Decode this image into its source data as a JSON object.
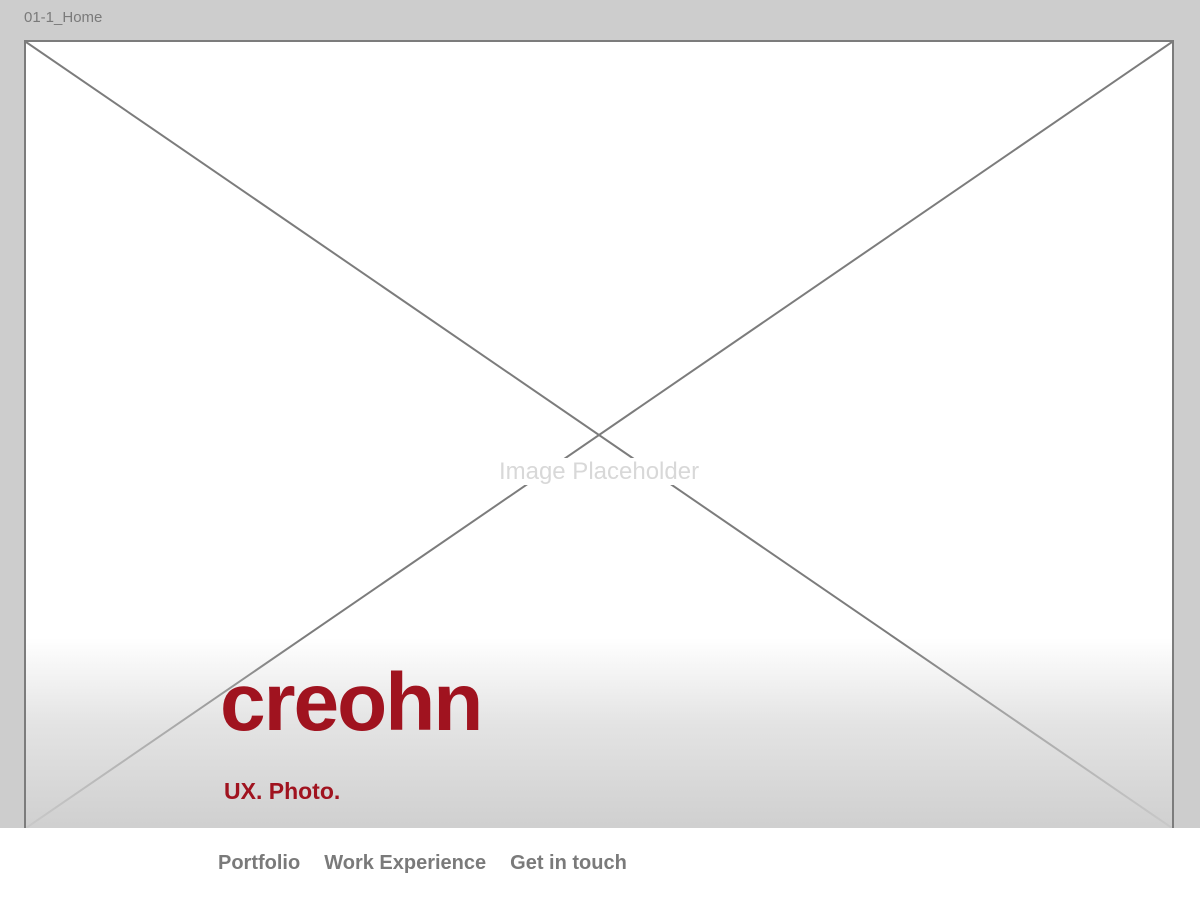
{
  "artboard": {
    "label": "01-1_Home"
  },
  "hero": {
    "placeholder_text": "Image Placeholder",
    "brand": "creohn",
    "tagline": "UX. Photo."
  },
  "nav": {
    "items": [
      {
        "label": "Portfolio"
      },
      {
        "label": "Work Experience"
      },
      {
        "label": "Get in touch"
      }
    ]
  },
  "colors": {
    "brand_red": "#a0131f",
    "nav_gray": "#7a7a7a",
    "canvas_gray": "#cdcdcd"
  }
}
